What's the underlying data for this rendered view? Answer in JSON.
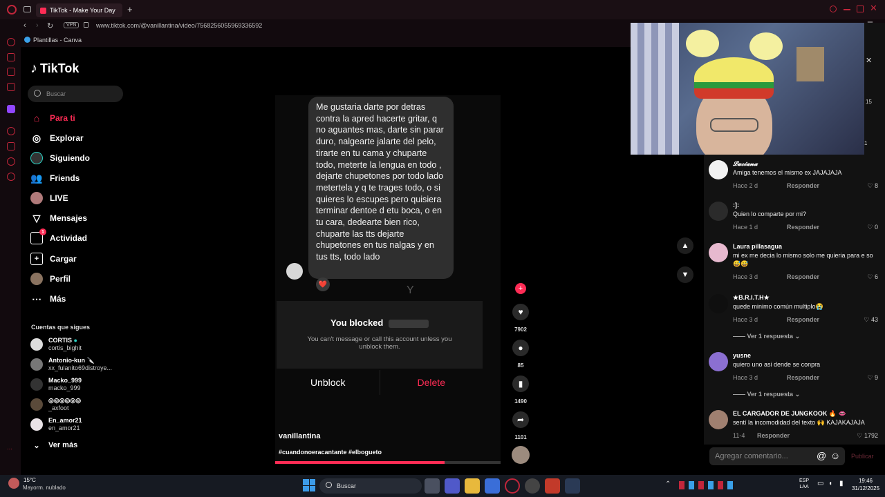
{
  "browser": {
    "tab_title": "TikTok - Make Your Day",
    "vpn_label": "VPN",
    "url": "www.tiktok.com/@vanillantina/video/7568256055969336592",
    "bookmark": "Plantillas - Canva"
  },
  "tiktok": {
    "logo": "TikTok",
    "search_placeholder": "Buscar",
    "nav": [
      {
        "label": "Para ti",
        "icon": "home-icon"
      },
      {
        "label": "Explorar",
        "icon": "compass-icon"
      },
      {
        "label": "Siguiendo",
        "icon": "following-icon"
      },
      {
        "label": "Friends",
        "icon": "friends-icon"
      },
      {
        "label": "LIVE",
        "icon": "live-icon"
      },
      {
        "label": "Mensajes",
        "icon": "messages-icon"
      },
      {
        "label": "Actividad",
        "icon": "activity-icon",
        "badge": "1"
      },
      {
        "label": "Cargar",
        "icon": "upload-icon"
      },
      {
        "label": "Perfil",
        "icon": "profile-icon"
      },
      {
        "label": "Más",
        "icon": "more-icon"
      }
    ],
    "following_header": "Cuentas que sigues",
    "following": [
      {
        "name": "CORTIS",
        "handle": "cortis_bighit"
      },
      {
        "name": "Antonio-kun 🔪",
        "handle": "xx_fulanito69distroye..."
      },
      {
        "name": "Macko_999",
        "handle": "macko_999"
      },
      {
        "name": "◎◎◎◎◎◎",
        "handle": "_axfoot"
      },
      {
        "name": "En_amor21",
        "handle": "en_amor21"
      }
    ],
    "see_more": "Ver más"
  },
  "video": {
    "message": "Me gustaria darte por detras contra la apred hacerte gritar, q no aguantes mas, darte sin parar duro, nalgearte jalarte del pelo, tirarte en tu cama y chuparte todo, meterte la lengua en todo , dejarte chupetones por todo lado metertela y q te trages todo, o si quieres lo escupes pero quisiera terminar dentoe d etu boca, o en tu cara, dedearte bien rico, chuparte las tts dejarte chupetones en tus nalgas y en tus tts, todo lado",
    "reaction": "❤️",
    "blocked_title": "You blocked",
    "blocked_desc": "You can't message or call this account unless you unblock them.",
    "unblock_label": "Unblock",
    "delete_label": "Delete",
    "author": "vanillantina",
    "hashtags": "#cuandonoeracantante #elbogueto",
    "stray_letter": "Y"
  },
  "actions": {
    "likes": "7902",
    "comments": "85",
    "saves": "1490",
    "shares": "1101"
  },
  "comments": [
    {
      "name": "𝓛𝓾𝓬𝓲𝓪𝓷𝓪",
      "text": "Amiga tenemos el mismo ex JAJAJAJA",
      "time": "Hace 2 d",
      "likes": "8"
    },
    {
      "name": ":]:",
      "text": "Quien lo comparte por mi?",
      "time": "Hace 1 d",
      "likes": "0"
    },
    {
      "name": "Laura pillasagua",
      "text": "mi ex me decia lo mismo solo me quieria para e so 😅😅",
      "time": "Hace 3 d",
      "likes": "6"
    },
    {
      "name": "★B.R.I.T.H★",
      "text": "quede minimo común multiplo😭",
      "time": "Hace 3 d",
      "likes": "43"
    },
    {
      "name": "yusne",
      "text": "quiero uno asi dende se conpra",
      "time": "Hace 3 d",
      "likes": "9"
    },
    {
      "name": "EL CARGADOR DE JUNGKOOK 🔥 👄",
      "text": "sentí la incomodidad del texto 🙌 KAJAKAJAJA",
      "time": "11-4",
      "likes": "1792"
    }
  ],
  "reply_label": "Responder",
  "see_replies": "Ver 1 respuesta",
  "comment_placeholder": "Agregar comentario...",
  "publish_label": "Publicar",
  "partial_counts": {
    "top": "15",
    "second": "1"
  },
  "taskbar": {
    "temp": "15°C",
    "weather": "Mayorm. nublado",
    "search": "Buscar",
    "lang1": "ESP",
    "lang2": "LAA",
    "time": "19:46",
    "date": "31/12/2025"
  },
  "colors": {
    "tiktok_red": "#fe2c55",
    "opera_red": "#c2263b",
    "badge_red": "#ff3b5c"
  }
}
